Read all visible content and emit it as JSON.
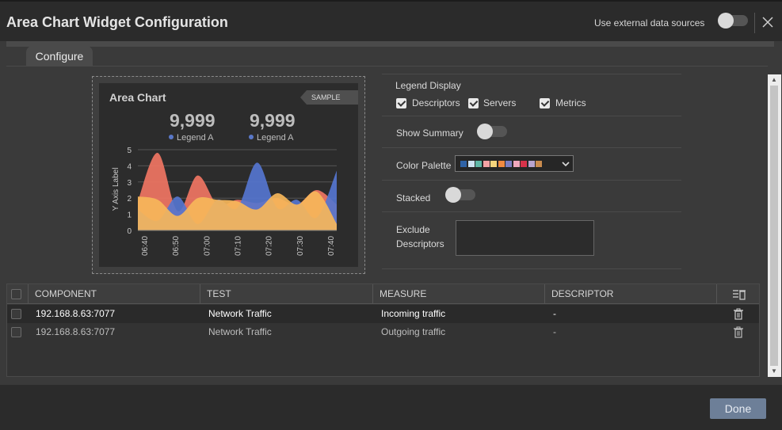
{
  "window": {
    "title": "Area Chart Widget Configuration",
    "external_sources_label": "Use external data sources"
  },
  "tabs": [
    {
      "label": "Configure"
    }
  ],
  "preview": {
    "chart_title": "Area Chart",
    "sample_badge": "SAMPLE DATA",
    "kpis": [
      {
        "value": "9,999",
        "legend": "Legend A"
      },
      {
        "value": "9,999",
        "legend": "Legend A"
      }
    ]
  },
  "chart_data": {
    "type": "area",
    "ylabel": "Y Axis Label",
    "ylim": [
      0,
      5
    ],
    "yticks": [
      "0",
      "1",
      "2",
      "3",
      "4",
      "5"
    ],
    "x": [
      "06:40",
      "06:50",
      "07:00",
      "07:10",
      "07:20",
      "07:30",
      "07:40"
    ],
    "series": [
      {
        "color": "#f07563",
        "values": [
          1.8,
          4.8,
          1.2,
          3.4,
          1.6,
          1.9,
          1.7,
          2.0,
          1.6,
          2.5,
          1.6
        ]
      },
      {
        "color": "#5575cf",
        "values": [
          1.3,
          0.6,
          2.1,
          0.4,
          1.9,
          1.4,
          4.2,
          1.4,
          1.9,
          0.8,
          3.7
        ]
      },
      {
        "color": "#f6b65a",
        "values": [
          2.1,
          1.9,
          0.9,
          2.0,
          1.9,
          1.8,
          1.3,
          2.3,
          1.6,
          2.4,
          0.4
        ]
      }
    ]
  },
  "settings": {
    "legend_display_label": "Legend Display",
    "legend_options": [
      {
        "label": "Descriptors",
        "checked": true
      },
      {
        "label": "Servers",
        "checked": true
      },
      {
        "label": "Metrics",
        "checked": true
      }
    ],
    "show_summary_label": "Show Summary",
    "show_summary_on": false,
    "color_palette_label": "Color Palette",
    "palette_colors": [
      "#2f63a7",
      "#cfe3f2",
      "#5fb7a7",
      "#f4a3a5",
      "#f5d57c",
      "#f08a42",
      "#7c7ec2",
      "#f0a7bd",
      "#d7324a",
      "#b9a4cf",
      "#c98b4e"
    ],
    "stacked_label": "Stacked",
    "stacked_on": false,
    "exclude_label_1": "Exclude",
    "exclude_label_2": "Descriptors"
  },
  "table": {
    "columns": [
      "COMPONENT",
      "TEST",
      "MEASURE",
      "DESCRIPTOR"
    ],
    "rows": [
      {
        "component": "192.168.8.63:7077",
        "test": "Network Traffic",
        "measure": "Incoming traffic",
        "descriptor": "-"
      },
      {
        "component": "192.168.8.63:7077",
        "test": "Network Traffic",
        "measure": "Outgoing traffic",
        "descriptor": "-"
      }
    ]
  },
  "footer": {
    "done_label": "Done"
  }
}
